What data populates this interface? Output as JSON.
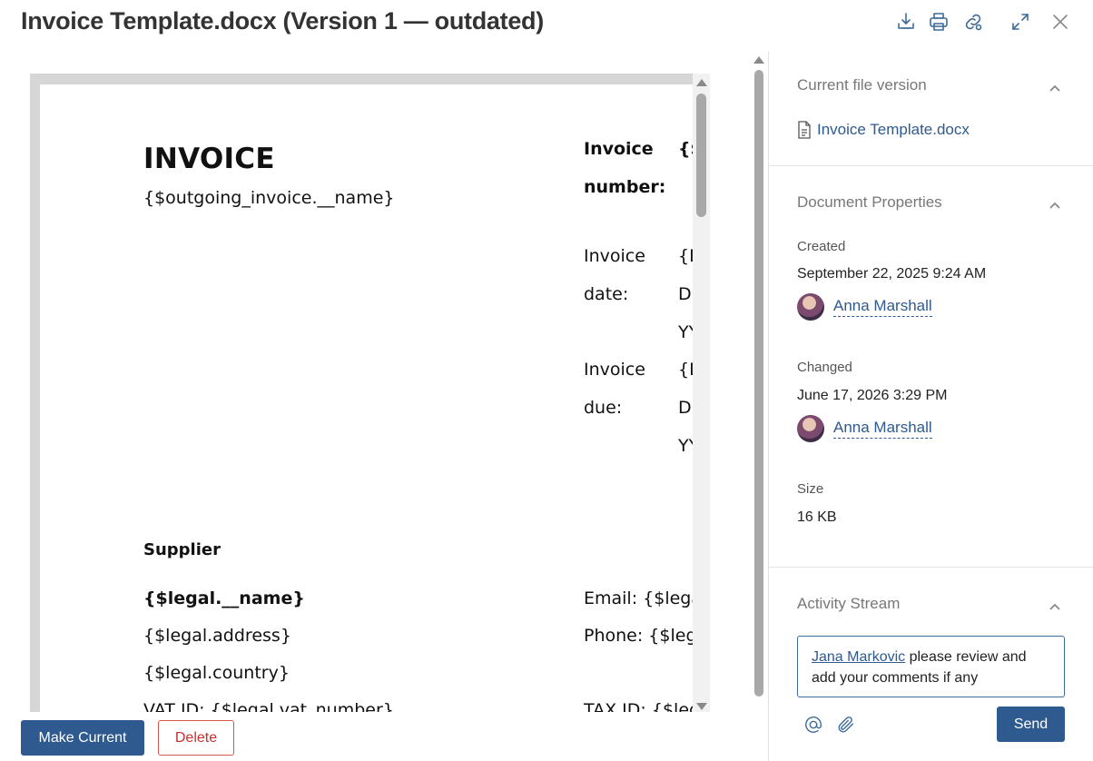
{
  "window": {
    "title": "Invoice Template.docx (Version 1 — outdated)"
  },
  "toolbar": {
    "icons": [
      "download-icon",
      "print-icon",
      "link-icon",
      "expand-icon",
      "close-icon"
    ]
  },
  "document": {
    "heading": "INVOICE",
    "name_field": "{$outgoing_invoice.__name}",
    "invoice_number_label_1": "Invoice",
    "invoice_number_label_2": "number:",
    "invoice_number_value": "{$",
    "invoice_date_label_1": "Invoice",
    "invoice_date_label_2": "date:",
    "invoice_date_value_1": "{D",
    "invoice_date_value_2": "D",
    "invoice_date_value_3": "YY",
    "invoice_due_label_1": "Invoice",
    "invoice_due_label_2": "due:",
    "invoice_due_value_1": "{D",
    "invoice_due_value_2": "D",
    "invoice_due_value_3": "YY",
    "supplier_heading": "Supplier",
    "legal_name": "{$legal.__name}",
    "legal_address": "{$legal.address}",
    "legal_country": "{$legal.country}",
    "legal_vat": "VAT ID: {$legal.vat_number}",
    "email_line": "Email: {$lega",
    "phone_line": "Phone: {$lega",
    "tax_line": "TAX ID: {$leg"
  },
  "actions": {
    "make_current": "Make Current",
    "delete": "Delete"
  },
  "panel": {
    "current_version": {
      "heading": "Current file version",
      "file_name": "Invoice Template.docx"
    },
    "properties": {
      "heading": "Document Properties",
      "created_label": "Created",
      "created_value": "September 22, 2025 9:24 AM",
      "created_by": "Anna Marshall",
      "changed_label": "Changed",
      "changed_value": "June 17, 2026 3:29 PM",
      "changed_by": "Anna Marshall",
      "size_label": "Size",
      "size_value": "16 KB"
    },
    "activity": {
      "heading": "Activity Stream",
      "mention": "Jana Markovic",
      "comment_text": " please review and add your comments if any",
      "send_label": "Send"
    }
  },
  "colors": {
    "accent": "#2f5a8f",
    "danger": "#c9302c"
  }
}
